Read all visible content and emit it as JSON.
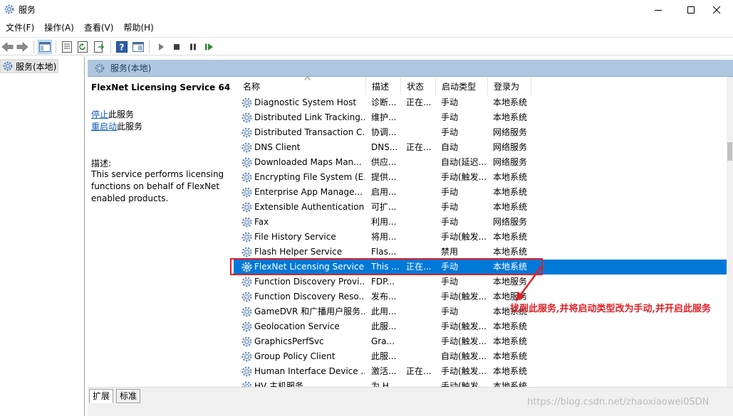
{
  "window": {
    "title": "服务",
    "minimize_icon": "minimize-icon",
    "maximize_icon": "maximize-icon",
    "close_icon": "close-icon"
  },
  "menu": [
    "文件(F)",
    "操作(A)",
    "查看(V)",
    "帮助(H)"
  ],
  "toolbar": {
    "icons": [
      "back-arrow-icon",
      "forward-arrow-icon",
      "console-tree-icon",
      "properties-icon",
      "refresh-icon",
      "export-icon",
      "help-icon",
      "view-icon",
      "start-icon",
      "stop-icon",
      "pause-icon",
      "resume-icon"
    ]
  },
  "tree": {
    "root_label": "服务(本地)"
  },
  "panel": {
    "header": "服务(本地)"
  },
  "detail": {
    "title": "FlexNet Licensing Service 64",
    "stop_link": "停止",
    "stop_suffix": "此服务",
    "restart_link": "重启动",
    "restart_suffix": "此服务",
    "desc_label": "描述:",
    "desc_lines": [
      "This service performs licensing",
      "functions on behalf of FlexNet",
      "enabled products."
    ]
  },
  "columns": [
    "名称",
    "描述",
    "状态",
    "启动类型",
    "登录为"
  ],
  "services": [
    {
      "name": "Diagnostic System Host",
      "desc": "诊断...",
      "status": "正在...",
      "startup": "手动",
      "logon": "本地系统"
    },
    {
      "name": "Distributed Link Tracking...",
      "desc": "维护...",
      "status": "",
      "startup": "手动",
      "logon": "本地系统"
    },
    {
      "name": "Distributed Transaction C...",
      "desc": "协调...",
      "status": "",
      "startup": "手动",
      "logon": "网络服务"
    },
    {
      "name": "DNS Client",
      "desc": "DNS...",
      "status": "正在...",
      "startup": "自动",
      "logon": "网络服务"
    },
    {
      "name": "Downloaded Maps Man...",
      "desc": "供应...",
      "status": "",
      "startup": "自动(延迟...",
      "logon": "网络服务"
    },
    {
      "name": "Encrypting File System (E...",
      "desc": "提供...",
      "status": "",
      "startup": "手动(触发...",
      "logon": "本地系统"
    },
    {
      "name": "Enterprise App Manage...",
      "desc": "启用...",
      "status": "",
      "startup": "手动",
      "logon": "本地系统"
    },
    {
      "name": "Extensible Authentication...",
      "desc": "可扩...",
      "status": "",
      "startup": "手动",
      "logon": "本地系统"
    },
    {
      "name": "Fax",
      "desc": "利用...",
      "status": "",
      "startup": "手动",
      "logon": "网络服务"
    },
    {
      "name": "File History Service",
      "desc": "将用...",
      "status": "",
      "startup": "手动(触发...",
      "logon": "本地系统"
    },
    {
      "name": "Flash Helper Service",
      "desc": "Flas...",
      "status": "",
      "startup": "禁用",
      "logon": "本地系统"
    },
    {
      "name": "FlexNet Licensing Service...",
      "desc": "This ...",
      "status": "正在...",
      "startup": "手动",
      "logon": "本地系统"
    },
    {
      "name": "Function Discovery Provi...",
      "desc": "FDP...",
      "status": "",
      "startup": "手动",
      "logon": "本地服务"
    },
    {
      "name": "Function Discovery Reso...",
      "desc": "发布...",
      "status": "",
      "startup": "手动(触发...",
      "logon": "本地服务"
    },
    {
      "name": "GameDVR 和广播用户服务...",
      "desc": "此用...",
      "status": "",
      "startup": "手动",
      "logon": "本地系统"
    },
    {
      "name": "Geolocation Service",
      "desc": "此服...",
      "status": "",
      "startup": "手动(触发...",
      "logon": "本地系统"
    },
    {
      "name": "GraphicsPerfSvc",
      "desc": "Gra...",
      "status": "",
      "startup": "手动(触发...",
      "logon": "本地系统"
    },
    {
      "name": "Group Policy Client",
      "desc": "此服...",
      "status": "",
      "startup": "自动(触发...",
      "logon": "本地系统"
    },
    {
      "name": "Human Interface Device ...",
      "desc": "激活...",
      "status": "正在...",
      "startup": "手动(触发...",
      "logon": "本地系统"
    },
    {
      "name": "HV 主机服务",
      "desc": "为 H...",
      "status": "",
      "startup": "手动(触发...",
      "logon": "本地系统"
    }
  ],
  "selected_index": 11,
  "tabs": [
    "扩展",
    "标准"
  ],
  "annotation": "找到此服务,并将启动类型改为手动,并开启此服务",
  "watermark": "https://blog.csdn.net/zhaoxiaowei0SDN",
  "colors": {
    "selection": "#0078d7",
    "annotation": "#e21f25",
    "header_bg": "#afc6e0",
    "link": "#0c5cc2"
  }
}
